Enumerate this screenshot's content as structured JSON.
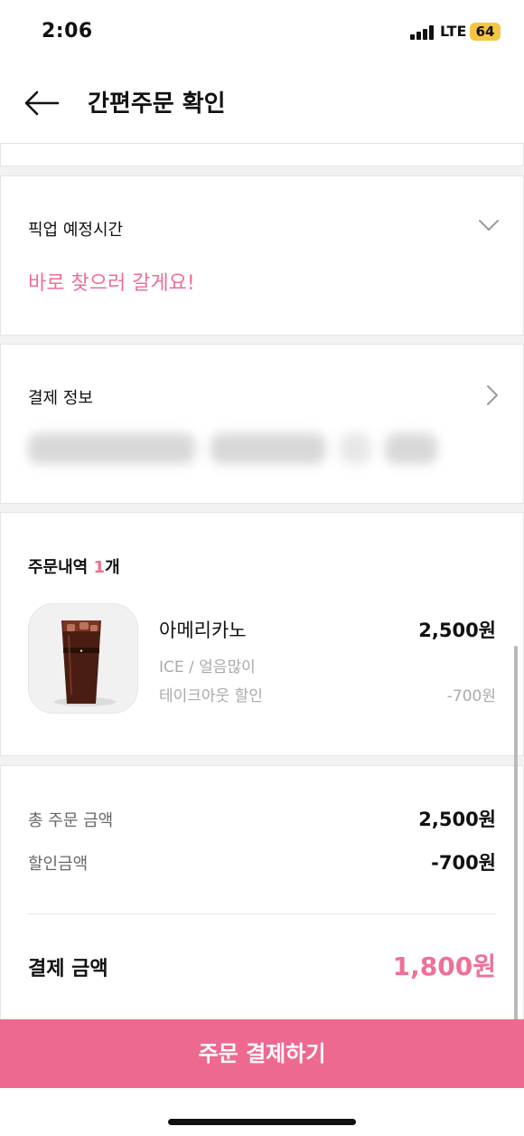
{
  "status": {
    "time": "2:06",
    "network": "LTE",
    "battery": "64"
  },
  "header": {
    "title": "간편주문 확인"
  },
  "pickup": {
    "label": "픽업 예정시간",
    "value": "바로 찾으러 갈게요!"
  },
  "payment_info": {
    "label": "결제 정보"
  },
  "order": {
    "title": "주문내역",
    "count": "1",
    "count_suffix": "개",
    "item": {
      "name": "아메리카노",
      "price": "2,500원",
      "options": "ICE / 얼음많이",
      "discount_label": "테이크아웃 할인",
      "discount_value": "-700원"
    }
  },
  "summary": {
    "total_label": "총 주문 금액",
    "total_value": "2,500원",
    "discount_label": "할인금액",
    "discount_value": "-700원",
    "pay_label": "결제 금액",
    "pay_value": "1,800원"
  },
  "cta": {
    "label": "주문 결제하기"
  },
  "colors": {
    "accent": "#ee6990",
    "accent_text": "#ee6f93"
  }
}
